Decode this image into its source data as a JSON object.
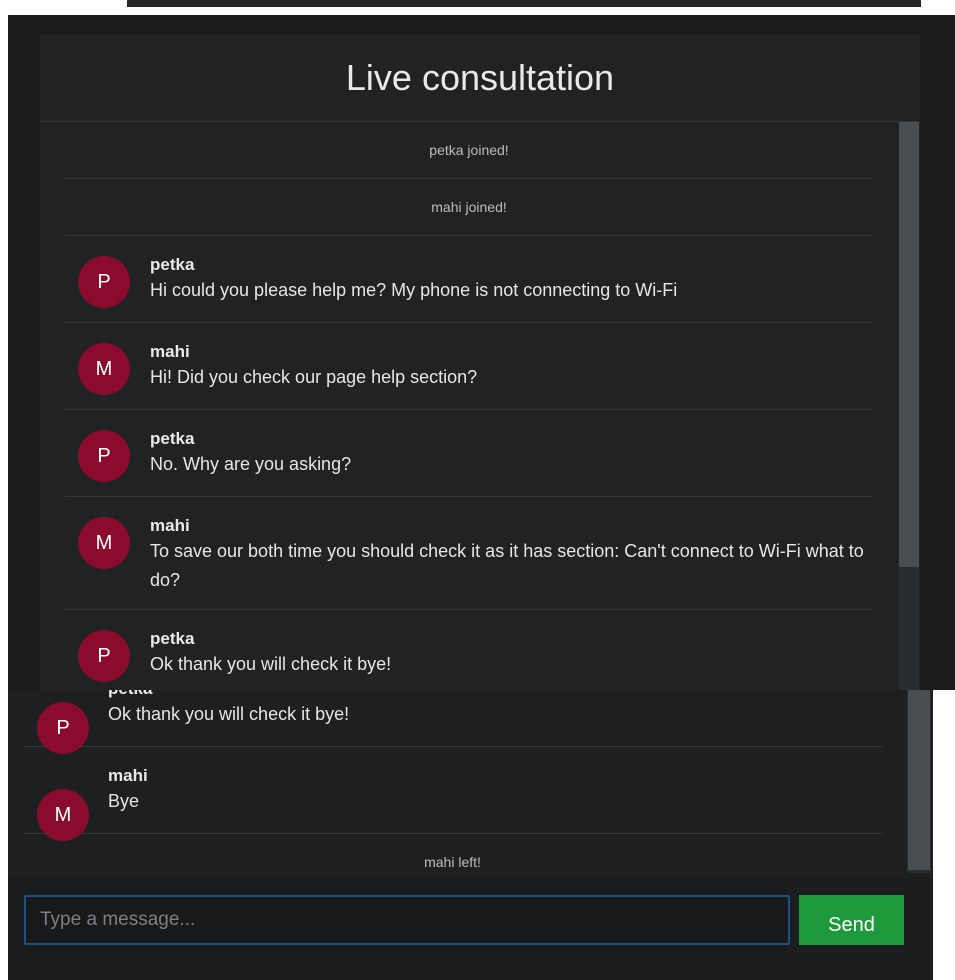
{
  "header": {
    "title": "Live consultation"
  },
  "upper_messages": [
    {
      "type": "system",
      "text": "petka joined!"
    },
    {
      "type": "system",
      "text": "mahi joined!"
    },
    {
      "type": "message",
      "initial": "P",
      "author": "petka",
      "text": "Hi could you please help me? My phone is not connecting to Wi-Fi"
    },
    {
      "type": "message",
      "initial": "M",
      "author": "mahi",
      "text": "Hi! Did you check our page help section?"
    },
    {
      "type": "message",
      "initial": "P",
      "author": "petka",
      "text": "No. Why are you asking?"
    },
    {
      "type": "message",
      "initial": "M",
      "author": "mahi",
      "text": "To save our both time you should check it as it has section: Can't connect to Wi-Fi what to do?"
    },
    {
      "type": "message",
      "initial": "P",
      "author": "petka",
      "text": "Ok thank you will check it bye!"
    }
  ],
  "lower_messages": [
    {
      "type": "message",
      "initial": "P",
      "author": "petka",
      "text": "Ok thank you will check it bye!"
    },
    {
      "type": "message",
      "initial": "M",
      "author": "mahi",
      "text": "Bye"
    },
    {
      "type": "system",
      "text": "mahi left!"
    }
  ],
  "composer": {
    "placeholder": "Type a message...",
    "value": "",
    "send_label": "Send"
  },
  "colors": {
    "avatar": "#8a0b2b",
    "send": "#1e9a3c",
    "input_border": "#1f4f86",
    "background": "#202224"
  }
}
